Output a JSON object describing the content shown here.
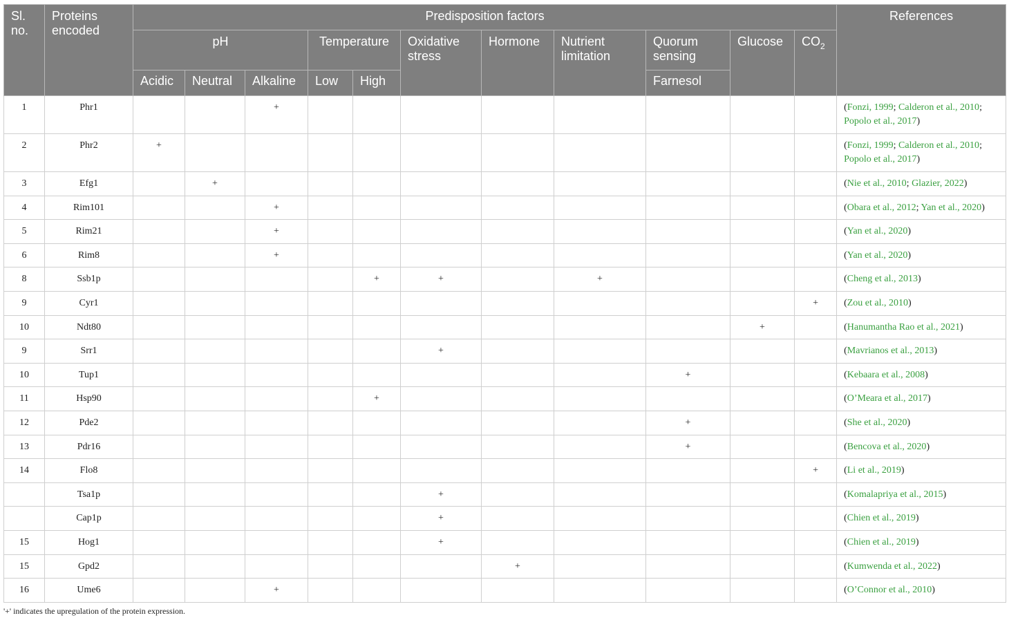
{
  "header": {
    "sl_no": "Sl. no.",
    "proteins": "Proteins encoded",
    "predisposition": "Predisposition factors",
    "references": "References",
    "ph": "pH",
    "temperature": "Temperature",
    "oxidative": "Oxidative stress",
    "hormone": "Hormone",
    "nutrient": "Nutrient limitation",
    "quorum": "Quorum sensing",
    "glucose": "Glucose",
    "co2_main": "CO",
    "co2_sub": "2",
    "acidic": "Acidic",
    "neutral": "Neutral",
    "alkaline": "Alkaline",
    "low": "Low",
    "high": "High",
    "farnesol": "Farnesol"
  },
  "columns": [
    "acidic",
    "neutral",
    "alkaline",
    "low",
    "high",
    "oxidative",
    "hormone",
    "nutrient",
    "farnesol",
    "glucose",
    "co2"
  ],
  "rows": [
    {
      "no": "1",
      "protein": "Phr1",
      "marks": [
        "alkaline"
      ],
      "refs": [
        "Fonzi, 1999",
        "Calderon et al., 2010",
        "Popolo et al., 2017"
      ],
      "tall": true
    },
    {
      "no": "2",
      "protein": "Phr2",
      "marks": [
        "acidic"
      ],
      "refs": [
        "Fonzi, 1999",
        "Calderon et al., 2010",
        "Popolo et al., 2017"
      ],
      "tall": true
    },
    {
      "no": "3",
      "protein": "Efg1",
      "marks": [
        "neutral"
      ],
      "refs": [
        "Nie et al., 2010",
        "Glazier, 2022"
      ]
    },
    {
      "no": "4",
      "protein": "Rim101",
      "marks": [
        "alkaline"
      ],
      "refs": [
        "Obara et al., 2012",
        "Yan et al., 2020"
      ]
    },
    {
      "no": "5",
      "protein": "Rim21",
      "marks": [
        "alkaline"
      ],
      "refs": [
        "Yan et al., 2020"
      ]
    },
    {
      "no": "6",
      "protein": "Rim8",
      "marks": [
        "alkaline"
      ],
      "refs": [
        "Yan et al., 2020"
      ]
    },
    {
      "no": "8",
      "protein": "Ssb1p",
      "marks": [
        "high",
        "oxidative",
        "nutrient"
      ],
      "refs": [
        "Cheng et al., 2013"
      ]
    },
    {
      "no": "9",
      "protein": "Cyr1",
      "marks": [
        "co2"
      ],
      "refs": [
        "Zou et al., 2010"
      ]
    },
    {
      "no": "10",
      "protein": "Ndt80",
      "marks": [
        "glucose"
      ],
      "refs": [
        "Hanumantha Rao et al., 2021"
      ]
    },
    {
      "no": "9",
      "protein": "Srr1",
      "marks": [
        "oxidative"
      ],
      "refs": [
        "Mavrianos et al., 2013"
      ]
    },
    {
      "no": "10",
      "protein": "Tup1",
      "marks": [
        "farnesol"
      ],
      "refs": [
        "Kebaara et al., 2008"
      ]
    },
    {
      "no": "11",
      "protein": "Hsp90",
      "marks": [
        "high"
      ],
      "refs": [
        "O’Meara et al., 2017"
      ]
    },
    {
      "no": "12",
      "protein": "Pde2",
      "marks": [
        "farnesol"
      ],
      "refs": [
        "She et al., 2020"
      ]
    },
    {
      "no": "13",
      "protein": "Pdr16",
      "marks": [
        "farnesol"
      ],
      "refs": [
        "Bencova et al., 2020"
      ]
    },
    {
      "no": "14",
      "protein": "Flo8",
      "marks": [
        "co2"
      ],
      "refs": [
        "Li et al., 2019"
      ]
    },
    {
      "no": "",
      "protein": "Tsa1p",
      "marks": [
        "oxidative"
      ],
      "refs": [
        "Komalapriya et al., 2015"
      ]
    },
    {
      "no": "",
      "protein": "Cap1p",
      "marks": [
        "oxidative"
      ],
      "refs": [
        "Chien et al., 2019"
      ]
    },
    {
      "no": "15",
      "protein": "Hog1",
      "marks": [
        "oxidative"
      ],
      "refs": [
        "Chien et al., 2019"
      ]
    },
    {
      "no": "15",
      "protein": "Gpd2",
      "marks": [
        "hormone"
      ],
      "refs": [
        "Kumwenda et al., 2022"
      ]
    },
    {
      "no": "16",
      "protein": "Ume6",
      "marks": [
        "alkaline"
      ],
      "refs": [
        "O’Connor et al., 2010"
      ]
    }
  ],
  "mark_symbol": "+",
  "footnote": "'+' indicates the upregulation of the protein expression.",
  "colors": {
    "header_bg": "#7f7f7f",
    "link": "#3aa040"
  }
}
